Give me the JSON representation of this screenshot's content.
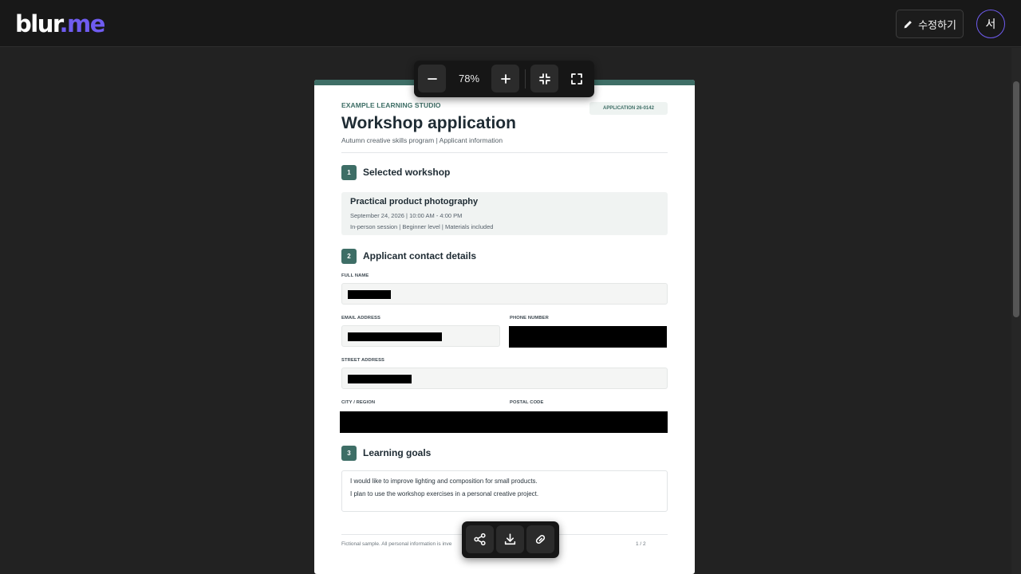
{
  "app": {
    "logo_main": "blur",
    "logo_accent": ".me",
    "edit_label": "수정하기",
    "avatar_initial": "서"
  },
  "zoom": {
    "level": "78%"
  },
  "document": {
    "org": "EXAMPLE LEARNING STUDIO",
    "application_badge": "APPLICATION 26-0142",
    "title": "Workshop application",
    "subtitle": "Autumn creative skills program | Applicant information",
    "sections": [
      {
        "number": "1",
        "title": "Selected workshop"
      },
      {
        "number": "2",
        "title": "Applicant contact details"
      },
      {
        "number": "3",
        "title": "Learning goals"
      }
    ],
    "workshop": {
      "name": "Practical product photography",
      "schedule": "September 24, 2026  |  10:00 AM - 4:00 PM",
      "details": "In-person session  |  Beginner level  |  Materials included"
    },
    "fields": {
      "full_name_label": "FULL NAME",
      "email_label": "EMAIL ADDRESS",
      "phone_label": "PHONE NUMBER",
      "street_label": "STREET ADDRESS",
      "city_label": "CITY / REGION",
      "postal_label": "POSTAL CODE"
    },
    "goals": [
      "I would like to improve lighting and composition for small products.",
      "I plan to use the workshop exercises in a personal creative project."
    ],
    "footer_note": "Fictional sample. All personal information is inve",
    "page_indicator": "1 / 2"
  },
  "icons": {
    "edit": "pencil-icon",
    "zoom_out": "minus-icon",
    "zoom_in": "plus-icon",
    "fit": "collapse-icon",
    "fullscreen": "expand-icon",
    "share": "share-icon",
    "download": "download-icon",
    "copy_link": "link-icon"
  },
  "colors": {
    "accent": "#6f5cf0",
    "doc_accent": "#3e6e66",
    "background": "#222222",
    "redaction": "#000000"
  }
}
